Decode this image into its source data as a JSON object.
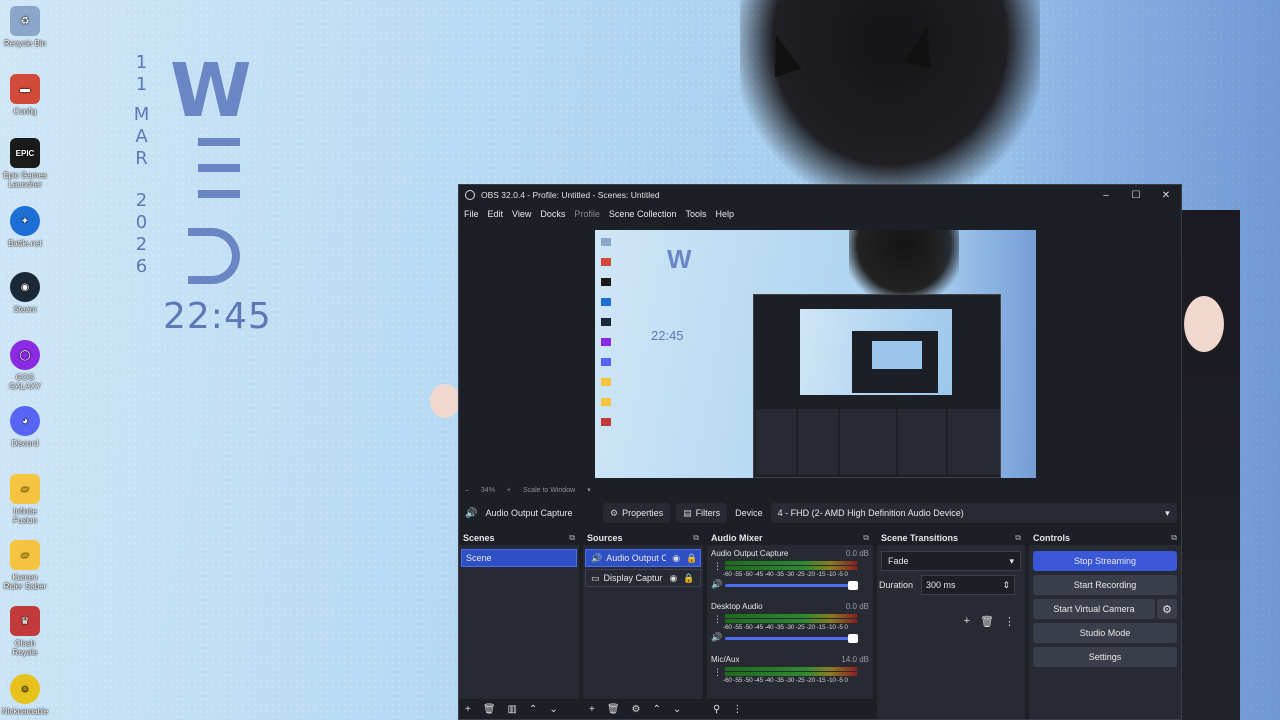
{
  "desktop": {
    "icons": [
      {
        "label": "Recycle Bin",
        "glyph": "♻",
        "color": "#8aa7c9"
      },
      {
        "label": "Config",
        "glyph": "▬",
        "color": "#d24a3a"
      },
      {
        "label": "Epic Games Launcher",
        "glyph": "EPIC",
        "color": "#1a1a1a"
      },
      {
        "label": "Battle.net",
        "glyph": "✦",
        "color": "#1d6fd6"
      },
      {
        "label": "Steam",
        "glyph": "◉",
        "color": "#1b2838"
      },
      {
        "label": "GOG GALAXY",
        "glyph": "◯",
        "color": "#8a2be2"
      },
      {
        "label": "Discord",
        "glyph": "◕",
        "color": "#5865f2"
      },
      {
        "label": "Infinite Fusion",
        "glyph": "▰",
        "color": "#f5c542"
      },
      {
        "label": "Kamen Rider Saber",
        "glyph": "▰",
        "color": "#f5c542"
      },
      {
        "label": "Clash Royale",
        "glyph": "♛",
        "color": "#c23a3a"
      },
      {
        "label": "Nicknamable",
        "glyph": "☺",
        "color": "#e8c21c"
      }
    ],
    "wallpaper": {
      "date_chars": [
        "1",
        "1",
        "",
        "M",
        "A",
        "R",
        "",
        "",
        "2",
        "0",
        "2",
        "6"
      ],
      "clock": "22:45",
      "logo": "W"
    }
  },
  "obs": {
    "title": "OBS 32.0.4 - Profile: Untitled - Scenes: Untitled",
    "window_buttons": {
      "minimize": "–",
      "maximize": "☐",
      "close": "✕"
    },
    "menu": [
      "File",
      "Edit",
      "View",
      "Docks",
      "Profile",
      "Scene Collection",
      "Tools",
      "Help"
    ],
    "preview_inner": {
      "clock": "22:45",
      "logo": "W"
    },
    "zoom": {
      "minus": "–",
      "percent": "34%",
      "plus": "+",
      "scale": "Scale to Window",
      "arrow": "▾"
    },
    "context": {
      "source": "Audio Output Capture",
      "properties": "Properties",
      "filters": "Filters",
      "device_label": "Device",
      "device_value": "4 - FHD (2- AMD High Definition Audio Device)"
    },
    "scenes": {
      "title": "Scenes",
      "items": [
        "Scene"
      ]
    },
    "sources": {
      "title": "Sources",
      "items": [
        "Audio Output C",
        "Display Captur"
      ]
    },
    "mixer": {
      "title": "Audio Mixer",
      "scale": "-60 -55 -50 -45 -40 -35 -30 -25 -20 -15 -10 -5 0",
      "channels": [
        {
          "name": "Audio Output Capture",
          "db": "0.0 dB"
        },
        {
          "name": "Desktop Audio",
          "db": "0.0 dB"
        },
        {
          "name": "Mic/Aux",
          "db": "14.0 dB"
        }
      ]
    },
    "transitions": {
      "title": "Scene Transitions",
      "selected": "Fade",
      "duration_label": "Duration",
      "duration_value": "300 ms"
    },
    "controls": {
      "title": "Controls",
      "stop_streaming": "Stop Streaming",
      "start_recording": "Start Recording",
      "start_virtual_camera": "Start Virtual Camera",
      "studio_mode": "Studio Mode",
      "settings": "Settings"
    }
  }
}
